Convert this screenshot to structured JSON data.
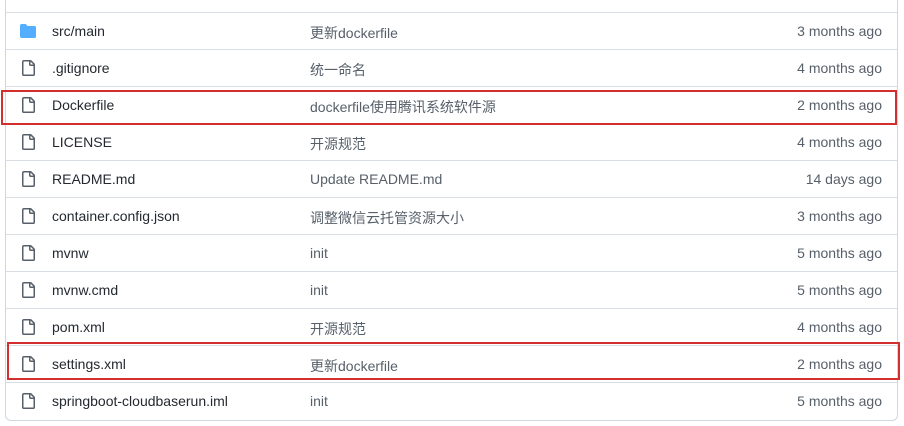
{
  "files": [
    {
      "name": "src/main",
      "type": "directory",
      "icon": "folder-icon",
      "message": "更新dockerfile",
      "age": "3 months ago"
    },
    {
      "name": ".gitignore",
      "type": "file",
      "icon": "file-icon",
      "message": "统一命名",
      "age": "4 months ago"
    },
    {
      "name": "Dockerfile",
      "type": "file",
      "icon": "file-icon",
      "message": "dockerfile使用腾讯系统软件源",
      "age": "2 months ago"
    },
    {
      "name": "LICENSE",
      "type": "file",
      "icon": "file-icon",
      "message": "开源规范",
      "age": "4 months ago"
    },
    {
      "name": "README.md",
      "type": "file",
      "icon": "file-icon",
      "message": "Update README.md",
      "age": "14 days ago"
    },
    {
      "name": "container.config.json",
      "type": "file",
      "icon": "file-icon",
      "message": "调整微信云托管资源大小",
      "age": "3 months ago"
    },
    {
      "name": "mvnw",
      "type": "file",
      "icon": "file-icon",
      "message": "init",
      "age": "5 months ago"
    },
    {
      "name": "mvnw.cmd",
      "type": "file",
      "icon": "file-icon",
      "message": "init",
      "age": "5 months ago"
    },
    {
      "name": "pom.xml",
      "type": "file",
      "icon": "file-icon",
      "message": "开源规范",
      "age": "4 months ago"
    },
    {
      "name": "settings.xml",
      "type": "file",
      "icon": "file-icon",
      "message": "更新dockerfile",
      "age": "2 months ago"
    },
    {
      "name": "springboot-cloudbaserun.iml",
      "type": "file",
      "icon": "file-icon",
      "message": "init",
      "age": "5 months ago"
    }
  ],
  "colors": {
    "folder": "#54aeff",
    "file_icon": "#57606a",
    "highlight": "#d32f2f"
  }
}
